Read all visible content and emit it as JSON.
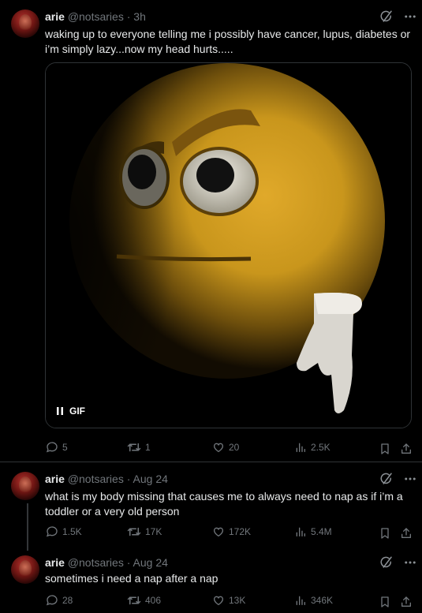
{
  "tweets": [
    {
      "name": "arie",
      "handle": "@notsaries",
      "time": "3h",
      "text": "waking up to everyone telling me i possibly have cancer, lupus, diabetes or i’m simply lazy...now my head hurts.....",
      "media_label": "GIF",
      "replies": "5",
      "retweets": "1",
      "likes": "20",
      "views": "2.5K"
    },
    {
      "name": "arie",
      "handle": "@notsaries",
      "time": "Aug 24",
      "text": "what is my body missing that causes me to always need to nap as if i’m a toddler or a very old person",
      "replies": "1.5K",
      "retweets": "17K",
      "likes": "172K",
      "views": "5.4M"
    },
    {
      "name": "arie",
      "handle": "@notsaries",
      "time": "Aug 24",
      "text": "sometimes i need a nap after a nap",
      "replies": "28",
      "retweets": "406",
      "likes": "13K",
      "views": "346K"
    }
  ],
  "separator": "·",
  "colors": {
    "background": "#000000",
    "text": "#e7e9ea",
    "muted": "#71767b",
    "border": "#2f3336",
    "emoji": "#c9961c"
  },
  "icons": [
    "grok-icon",
    "more-icon",
    "reply-icon",
    "retweet-icon",
    "like-icon",
    "views-icon",
    "bookmark-icon",
    "share-icon",
    "pause-icon"
  ]
}
